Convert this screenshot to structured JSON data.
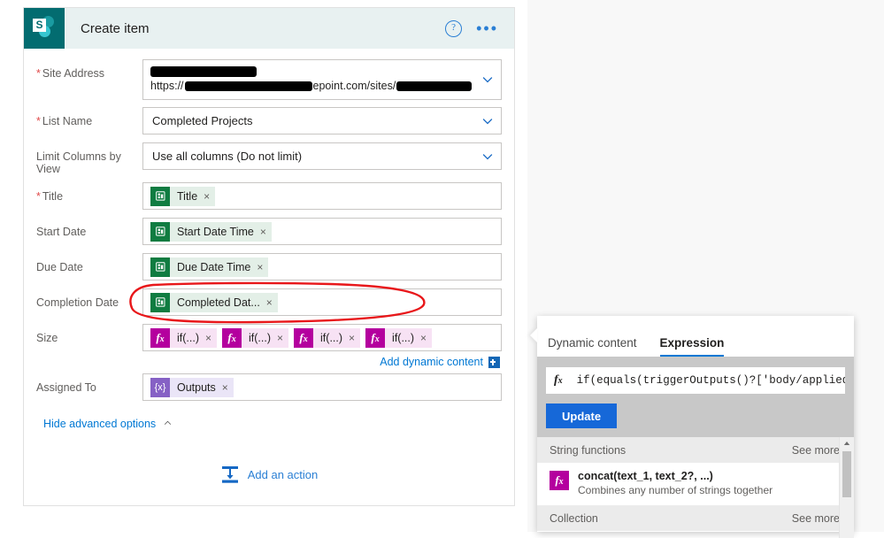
{
  "card": {
    "title": "Create item",
    "logo_icon": "sharepoint-icon",
    "logo_letter": "S",
    "help_icon": "?",
    "ellipsis_icon": "•••",
    "colors": {
      "header_bg": "#e8f1f1",
      "sharepoint_teal": "#036c70",
      "link_blue": "#0078d4",
      "token_green": "#107c41",
      "token_magenta": "#b4009e",
      "token_purple": "#8661c5",
      "annotation_red": "#e8171a",
      "update_blue": "#1668d8"
    }
  },
  "form": {
    "rows": [
      {
        "label": "Site Address",
        "required": true,
        "type": "site",
        "url_prefix": "https://",
        "url_mid": "epoint.com/sites/",
        "redacted": true,
        "chevron": "chevron-down-icon"
      },
      {
        "label": "List Name",
        "required": true,
        "type": "select",
        "value": "Completed Projects",
        "chevron": "chevron-down-icon"
      },
      {
        "label": "Limit Columns by View",
        "required": false,
        "type": "select",
        "value": "Use all columns (Do not limit)",
        "chevron": "chevron-down-icon"
      },
      {
        "label": "Title",
        "required": true,
        "type": "tokens",
        "tokens": [
          {
            "icon": "planner-icon",
            "color": "green",
            "label": "Title",
            "remove": "×"
          }
        ]
      },
      {
        "label": "Start Date",
        "required": false,
        "type": "tokens",
        "tokens": [
          {
            "icon": "planner-icon",
            "color": "green",
            "label": "Start Date Time",
            "remove": "×"
          }
        ]
      },
      {
        "label": "Due Date",
        "required": false,
        "type": "tokens",
        "tokens": [
          {
            "icon": "planner-icon",
            "color": "green",
            "label": "Due Date Time",
            "remove": "×"
          }
        ]
      },
      {
        "label": "Completion Date",
        "required": false,
        "type": "tokens",
        "tokens": [
          {
            "icon": "planner-icon",
            "color": "green",
            "label": "Completed Dat...",
            "remove": "×"
          }
        ]
      },
      {
        "label": "Size",
        "required": false,
        "type": "tokens",
        "annotated": true,
        "tokens": [
          {
            "icon": "fx-icon",
            "color": "magenta",
            "label": "if(...)",
            "remove": "×"
          },
          {
            "icon": "fx-icon",
            "color": "magenta",
            "label": "if(...)",
            "remove": "×"
          },
          {
            "icon": "fx-icon",
            "color": "magenta",
            "label": "if(...)",
            "remove": "×"
          },
          {
            "icon": "fx-icon",
            "color": "magenta",
            "label": "if(...)",
            "remove": "×"
          }
        ]
      },
      {
        "label": "Assigned To",
        "required": false,
        "type": "tokens",
        "tokens": [
          {
            "icon": "expression-icon",
            "color": "purple",
            "label": "Outputs",
            "remove": "×"
          }
        ]
      }
    ],
    "add_dynamic_content": {
      "label": "Add dynamic content",
      "icon": "insert-dynamic-content-icon"
    },
    "hide_advanced": {
      "label": "Hide advanced options",
      "icon": "chevron-up-icon"
    }
  },
  "add_action": {
    "label": "Add an action",
    "icon": "insert-action-icon"
  },
  "flyout": {
    "tabs": [
      {
        "label": "Dynamic content",
        "active": false
      },
      {
        "label": "Expression",
        "active": true
      }
    ],
    "expression": {
      "fx_icon": "fx-icon",
      "value": "if(equals(triggerOutputs()?['body/appliedC",
      "update_label": "Update"
    },
    "sections": [
      {
        "title": "String functions",
        "see_more": "See more",
        "items": [
          {
            "icon": "fx-icon",
            "name": "concat(text_1, text_2?, ...)",
            "description": "Combines any number of strings together"
          }
        ]
      },
      {
        "title": "Collection",
        "see_more": "See more",
        "items": []
      }
    ],
    "scrollbar": {
      "up_icon": "scroll-up-icon"
    }
  }
}
